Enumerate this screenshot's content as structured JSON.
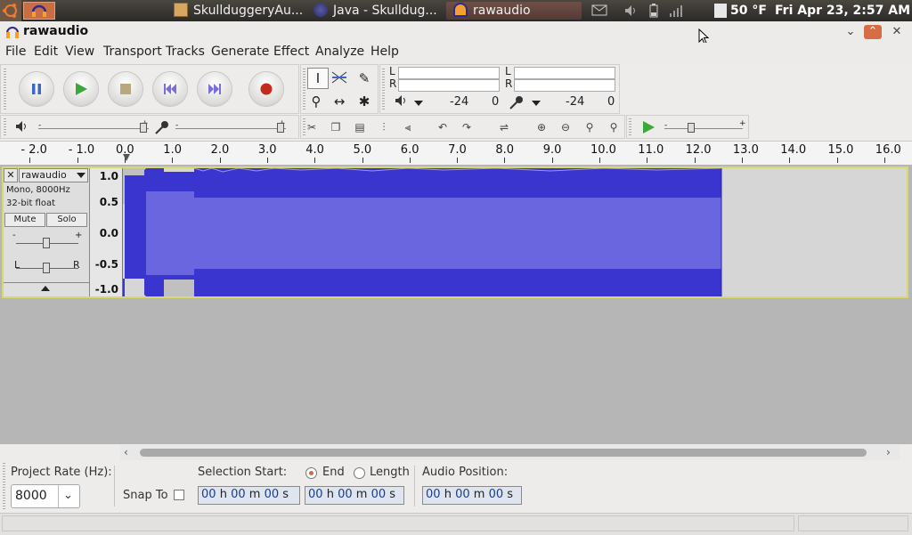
{
  "panel": {
    "tasks": [
      "SkullduggeryAu...",
      "Java - Skulldug...",
      "rawaudio"
    ],
    "temperature": "50 °F",
    "clock": "Fri Apr 23,  2:57 AM"
  },
  "window": {
    "title": "rawaudio"
  },
  "menu": [
    "File",
    "Edit",
    "View",
    "Transport",
    "Tracks",
    "Generate",
    "Effect",
    "Analyze",
    "Help"
  ],
  "meter": {
    "play_left": "L",
    "play_right": "R",
    "rec_left": "L",
    "rec_right": "R",
    "play_db": "-24",
    "play_zero": "0",
    "rec_db": "-24",
    "rec_zero": "0"
  },
  "ruler": {
    "ticks": [
      "- 2.0",
      "- 1.0",
      "0.0",
      "1.0",
      "2.0",
      "3.0",
      "4.0",
      "5.0",
      "6.0",
      "7.0",
      "8.0",
      "9.0",
      "10.0",
      "11.0",
      "12.0",
      "13.0",
      "14.0",
      "15.0",
      "16.0"
    ]
  },
  "track": {
    "name": "rawaudio",
    "info1": "Mono, 8000Hz",
    "info2": "32-bit float",
    "mute": "Mute",
    "solo": "Solo",
    "gain_minus": "-",
    "gain_plus": "+",
    "pan_left": "L",
    "pan_right": "R",
    "scale": [
      "1.0",
      "0.5",
      "0.0",
      "-0.5",
      "-1.0"
    ]
  },
  "selection": {
    "project_rate_label": "Project Rate (Hz):",
    "project_rate": "8000",
    "snap_to_label": "Snap To",
    "selection_start_label": "Selection Start:",
    "end_label": "End",
    "length_label": "Length",
    "audio_position_label": "Audio Position:",
    "time_start": [
      "00",
      "h",
      "00",
      "m",
      "00",
      "s"
    ],
    "time_end": [
      "00",
      "h",
      "00",
      "m",
      "00",
      "s"
    ],
    "time_pos": [
      "00",
      "h",
      "00",
      "m",
      "00",
      "s"
    ]
  },
  "colors": {
    "waveform": "#3a35cf",
    "waveform_rms": "#6a66e0",
    "track_border": "#d9d770",
    "record": "#c42b1c",
    "play": "#3aa83a",
    "panel": "#3b3833"
  }
}
